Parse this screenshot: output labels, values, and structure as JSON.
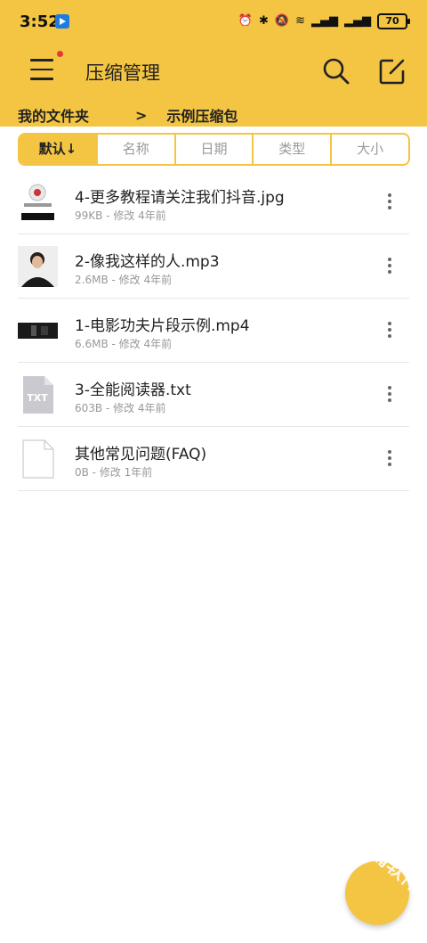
{
  "status_bar": {
    "time": "3:52",
    "battery": "70"
  },
  "header": {
    "title": "压缩管理"
  },
  "breadcrumb": {
    "root": "我的文件夹",
    "separator": ">",
    "current": "示例压缩包"
  },
  "sort_tabs": [
    {
      "label": "默认↓",
      "active": true
    },
    {
      "label": "名称",
      "active": false
    },
    {
      "label": "日期",
      "active": false
    },
    {
      "label": "类型",
      "active": false
    },
    {
      "label": "大小",
      "active": false
    }
  ],
  "files": [
    {
      "name": "4-更多教程请关注我们抖音.jpg",
      "meta": "99KB - 修改 4年前",
      "icon": "image-thumbnail"
    },
    {
      "name": "2-像我这样的人.mp3",
      "meta": "2.6MB - 修改 4年前",
      "icon": "audio-cover-thumbnail"
    },
    {
      "name": "1-电影功夫片段示例.mp4",
      "meta": "6.6MB - 修改 4年前",
      "icon": "video-thumbnail"
    },
    {
      "name": "3-全能阅读器.txt",
      "meta": "603B - 修改 4年前",
      "icon": "txt-file-icon",
      "icon_label": "TXT"
    },
    {
      "name": "其他常见问题(FAQ)",
      "meta": "0B - 修改 1年前",
      "icon": "blank-file-icon"
    }
  ],
  "watermark": "千篇软件站",
  "colors": {
    "accent": "#f4c542",
    "badge": "#e53935"
  }
}
